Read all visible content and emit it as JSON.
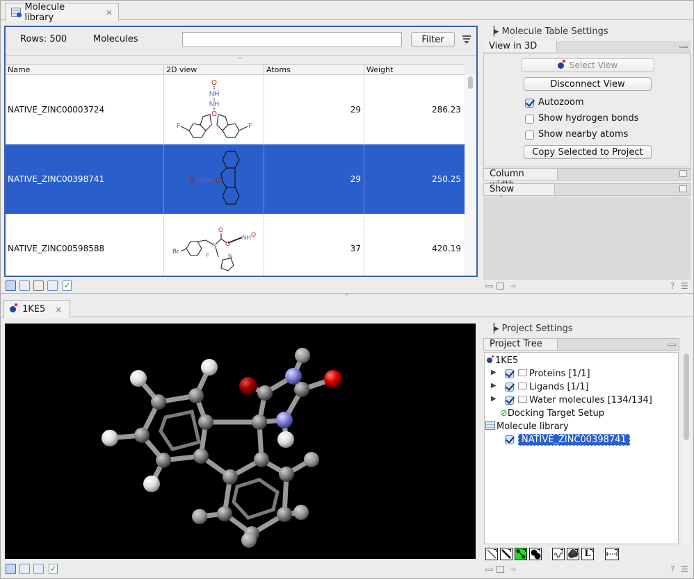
{
  "top_tab": {
    "label": "Molecule library",
    "close": "×",
    "icon": "table-icon"
  },
  "table_toolbar": {
    "rows_label": "Rows: 500",
    "molecules_label": "Molecules",
    "filter_input": {
      "value": "",
      "placeholder": ""
    },
    "filter_button": "Filter",
    "menu_icon": "filter-menu-icon"
  },
  "table": {
    "columns": [
      "Name",
      "2D view",
      "Atoms",
      "Weight"
    ],
    "rows": [
      {
        "name": "NATIVE_ZINC00003724",
        "atoms": "29",
        "weight": "286.23",
        "selected": false,
        "view_2d_labels": [
          "O",
          "NH",
          "NH",
          "O",
          "F",
          "F"
        ]
      },
      {
        "name": "NATIVE_ZINC00398741",
        "atoms": "29",
        "weight": "250.25",
        "selected": true,
        "view_2d_labels": [
          "O",
          "NHNH",
          "O"
        ]
      },
      {
        "name": "NATIVE_ZINC00598588",
        "atoms": "37",
        "weight": "420.19",
        "selected": false,
        "view_2d_labels": [
          "O",
          "NH",
          "O",
          "N",
          "O",
          "N",
          "Br",
          "F"
        ]
      }
    ]
  },
  "table_bottom_icons": [
    "table-view-icon",
    "info-icon",
    "molecule-table-icon",
    "history-icon",
    "checklist-icon"
  ],
  "table_settings": {
    "title": "Molecule Table Settings",
    "view3d": {
      "title": "View in 3D",
      "select_view": "Select View",
      "disconnect_view": "Disconnect View",
      "checkboxes": [
        {
          "label": "Autozoom",
          "checked": true
        },
        {
          "label": "Show hydrogen bonds",
          "checked": false
        },
        {
          "label": "Show nearby atoms",
          "checked": false
        }
      ],
      "copy_button": "Copy Selected to Project"
    },
    "column_width": "Column width",
    "show_column": "Show column",
    "help": "?"
  },
  "bottom_tab": {
    "label": "1KE5",
    "close": "×",
    "icon": "molecule-icon"
  },
  "viewer_bottom_icons": [
    "molecule-view-icon",
    "info-icon",
    "history-icon",
    "checklist-icon"
  ],
  "viewer_3d": {
    "background": "#000000",
    "atom_colors": {
      "carbon": "#8a8a8a",
      "hydrogen": "#e6e6e6",
      "nitrogen": "#8e8ee8",
      "oxygen": "#e01010"
    }
  },
  "project_settings": {
    "title": "Project Settings",
    "tree_title": "Project Tree",
    "tree": {
      "root": "1KE5",
      "children": [
        {
          "label": "Proteins [1/1]",
          "checked": true
        },
        {
          "label": "Ligands [1/1]",
          "checked": true
        },
        {
          "label": "Water molecules [134/134]",
          "checked": true
        }
      ],
      "docking": "Docking Target Setup",
      "library": "Molecule library",
      "library_item": {
        "label": "NATIVE_ZINC00398741",
        "checked": true,
        "selected": true
      }
    },
    "render_tools": [
      "wireframe-icon",
      "stick-icon",
      "ball-and-stick-icon",
      "space-fill-icon",
      "backbone-icon",
      "surface-icon",
      "label-icon",
      "measure-distance-icon"
    ],
    "active_tool": "ball-and-stick-icon",
    "help": "?"
  },
  "colors": {
    "selection": "#2a5fcb",
    "panel_border": "#3a5fab",
    "active_tool": "#1fe01f"
  }
}
